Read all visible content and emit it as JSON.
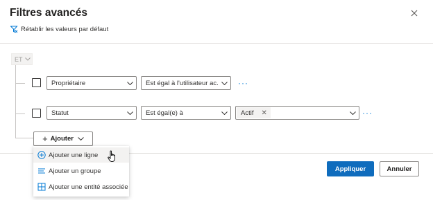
{
  "dialog": {
    "title": "Filtres avancés",
    "reset_label": "Rétablir les valeurs par défaut",
    "group_operator": "ET"
  },
  "rows": [
    {
      "field": "Propriétaire",
      "operator": "Est égal à l'utilisateur ac...",
      "more": "···"
    },
    {
      "field": "Statut",
      "operator": "Est égal(e) à",
      "value_tag": "Actif",
      "more": "···"
    }
  ],
  "add_button": {
    "label": "Ajouter",
    "plus": "+"
  },
  "add_menu": {
    "items": [
      {
        "label": "Ajouter une ligne",
        "icon": "add-circle-icon"
      },
      {
        "label": "Ajouter un groupe",
        "icon": "group-list-icon"
      },
      {
        "label": "Ajouter une entité associée",
        "icon": "related-entity-icon"
      }
    ]
  },
  "footer": {
    "apply_label": "Appliquer",
    "cancel_label": "Annuler"
  },
  "colors": {
    "accent": "#0f6cbd",
    "link": "#0078d4",
    "border": "#8a8886"
  }
}
